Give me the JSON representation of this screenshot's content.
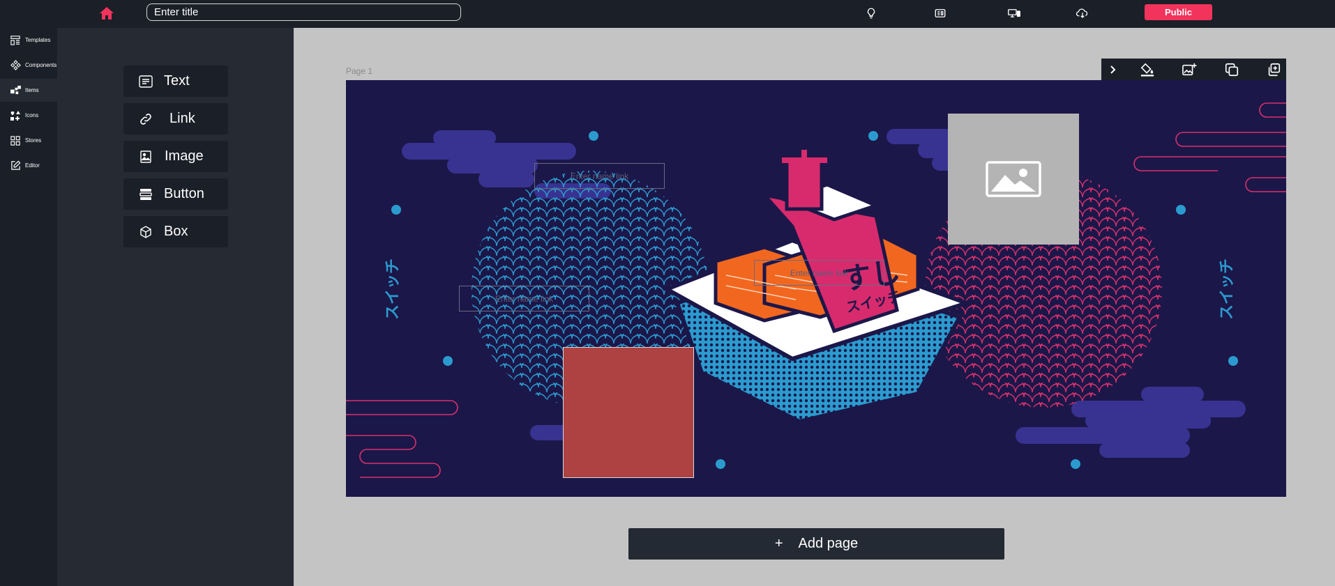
{
  "topbar": {
    "title_placeholder": "Enter title",
    "public_label": "Public",
    "icons": [
      "home-icon",
      "lightbulb-icon",
      "layout-icon",
      "devices-icon",
      "download-cloud-icon"
    ]
  },
  "nav": {
    "items": [
      {
        "label": "Templates",
        "icon": "templates-icon"
      },
      {
        "label": "Components",
        "icon": "components-icon"
      },
      {
        "label": "Items",
        "icon": "items-icon"
      },
      {
        "label": "Icons",
        "icon": "icons-icon"
      },
      {
        "label": "Stores",
        "icon": "stores-icon"
      },
      {
        "label": "Editor",
        "icon": "editor-icon"
      }
    ]
  },
  "panel": {
    "items": [
      {
        "label": "Text",
        "icon": "text-icon"
      },
      {
        "label": "Link",
        "icon": "link-icon"
      },
      {
        "label": "Image",
        "icon": "image-icon"
      },
      {
        "label": "Button",
        "icon": "button-icon"
      },
      {
        "label": "Box",
        "icon": "box-icon"
      }
    ]
  },
  "canvas": {
    "page_label": "Page 1",
    "link_placeholder": "Enter name link",
    "sushi_text_big": "すし",
    "sushi_text_small": "スイッチ",
    "side_text": "スイッチ",
    "add_page_label": "Add page"
  },
  "colors": {
    "accent": "#f2335c",
    "page_bg": "#1c1749",
    "dark": "#1b1f27",
    "panel": "#252a33",
    "workspace": "#c4c4c4",
    "box_fill": "#ae4242",
    "image_placeholder": "#b4b4b4"
  }
}
